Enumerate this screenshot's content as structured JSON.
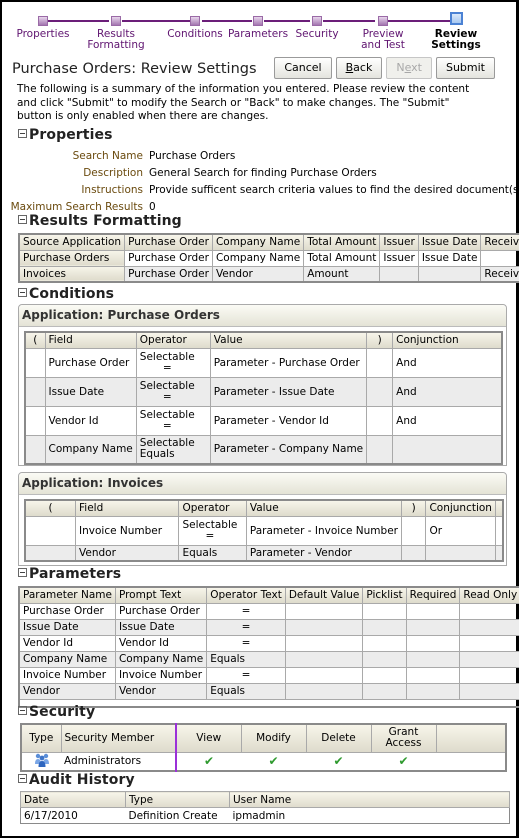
{
  "train": {
    "steps": [
      {
        "label_line1": "Properties",
        "label_line2": ""
      },
      {
        "label_line1": "Results",
        "label_line2": "Formatting"
      },
      {
        "label_line1": "Conditions",
        "label_line2": ""
      },
      {
        "label_line1": "Parameters",
        "label_line2": ""
      },
      {
        "label_line1": "Security",
        "label_line2": ""
      },
      {
        "label_line1": "Preview",
        "label_line2": "and Test"
      },
      {
        "label_line1": "Review",
        "label_line2": "Settings"
      }
    ],
    "current_step": "Review Settings"
  },
  "header": {
    "title": "Purchase Orders: Review Settings",
    "buttons": {
      "cancel": "Cancel",
      "back_mnemonic": "B",
      "back_rest": "ack",
      "next_pre": "N",
      "next_mnemonic": "e",
      "next_rest": "xt",
      "submit": "Submit"
    }
  },
  "intro": "The following is a summary of the information you entered. Please review the content and click \"Submit\" to modify the Search or \"Back\" to make changes. The \"Submit\" button is only enabled when there are changes.",
  "properties": {
    "heading": "Properties",
    "rows": [
      {
        "key": "Search Name",
        "value": "Purchase Orders"
      },
      {
        "key": "Description",
        "value": "General Search for finding Purchase Orders"
      },
      {
        "key": "Instructions",
        "value": "Provide sufficent search criteria values to find the desired document(s)."
      },
      {
        "key": "Maximum Search Results",
        "value": "0"
      }
    ]
  },
  "results_formatting": {
    "heading": "Results Formatting",
    "columns": [
      "Source Application",
      "Purchase Order",
      "Company Name",
      "Total Amount",
      "Issuer",
      "Issue Date",
      "Receive Date"
    ],
    "rows": [
      [
        "Purchase Orders",
        "Purchase Order",
        "Company Name",
        "Total Amount",
        "Issuer",
        "Issue Date",
        ""
      ],
      [
        "Invoices",
        "Purchase Order",
        "Vendor",
        "Amount",
        "",
        "",
        "Receive Date"
      ]
    ]
  },
  "conditions": {
    "heading": "Conditions",
    "columns": [
      "(",
      "Field",
      "Operator",
      "Value",
      ")",
      "Conjunction"
    ],
    "applications": [
      {
        "title": "Application: Purchase Orders",
        "rows": [
          {
            "open": "",
            "field": "Purchase Order",
            "op1": "Selectable",
            "op2": "=",
            "value": "Parameter - Purchase Order",
            "close": "",
            "conj": "And"
          },
          {
            "open": "",
            "field": "Issue Date",
            "op1": "Selectable",
            "op2": "=",
            "value": "Parameter - Issue Date",
            "close": "",
            "conj": "And"
          },
          {
            "open": "",
            "field": "Vendor Id",
            "op1": "Selectable",
            "op2": "=",
            "value": "Parameter - Vendor Id",
            "close": "",
            "conj": "And"
          },
          {
            "open": "",
            "field": "Company Name",
            "op1": "Selectable",
            "op2": "Equals",
            "value": "Parameter - Company Name",
            "close": "",
            "conj": ""
          }
        ]
      },
      {
        "title": "Application: Invoices",
        "rows": [
          {
            "open": "",
            "field": "Invoice Number",
            "op1": "Selectable",
            "op2": "=",
            "value": "Parameter - Invoice Number",
            "close": "",
            "conj": "Or"
          },
          {
            "open": "",
            "field": "Vendor",
            "op1": "Equals",
            "op2": "",
            "value": "Parameter - Vendor",
            "close": "",
            "conj": ""
          }
        ]
      }
    ]
  },
  "parameters": {
    "heading": "Parameters",
    "columns": [
      "Parameter Name",
      "Prompt Text",
      "Operator Text",
      "Default Value",
      "Picklist",
      "Required",
      "Read Only"
    ],
    "rows": [
      [
        "Purchase Order",
        "Purchase Order",
        "=",
        "",
        "",
        "",
        ""
      ],
      [
        "Issue Date",
        "Issue Date",
        "=",
        "",
        "",
        "",
        ""
      ],
      [
        "Vendor Id",
        "Vendor Id",
        "=",
        "",
        "",
        "",
        ""
      ],
      [
        "Company Name",
        "Company Name",
        "Equals",
        "",
        "",
        "",
        ""
      ],
      [
        "Invoice Number",
        "Invoice Number",
        "=",
        "",
        "",
        "",
        ""
      ],
      [
        "Vendor",
        "Vendor",
        "Equals",
        "",
        "",
        "",
        ""
      ]
    ]
  },
  "security": {
    "heading": "Security",
    "columns": {
      "type": "Type",
      "member": "Security Member",
      "view": "View",
      "modify": "Modify",
      "delete": "Delete",
      "grant1": "Grant",
      "grant2": "Access"
    },
    "rows": [
      {
        "type_icon": "user-group-icon",
        "member": "Administrators",
        "view": "✔",
        "modify": "✔",
        "delete": "✔",
        "grant": "✔"
      }
    ]
  },
  "audit": {
    "heading": "Audit History",
    "columns": [
      "Date",
      "Type",
      "User Name"
    ],
    "rows": [
      [
        "6/17/2010",
        "Definition Create",
        "ipmadmin"
      ]
    ]
  },
  "colors": {
    "train_purple": "#6b1e79",
    "current_step_blue": "#4b82d4",
    "label_brown": "#6a4a0e",
    "check_green": "#2e9a2e"
  }
}
